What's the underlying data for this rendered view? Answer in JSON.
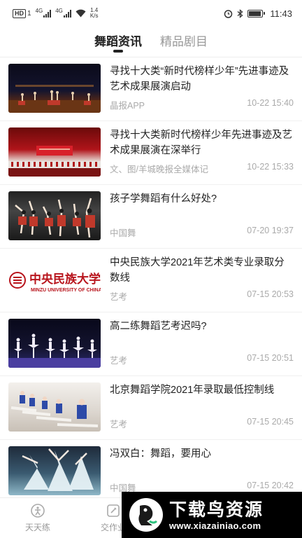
{
  "status_bar": {
    "hd": "HD",
    "sim": "1",
    "net1": "4G",
    "net2": "4G",
    "speed_value": "1.4",
    "speed_unit": "K/s",
    "battery_level": 0.85,
    "time": "11:43"
  },
  "tabs": [
    {
      "label": "舞蹈资讯",
      "active": true
    },
    {
      "label": "精品剧目",
      "active": false
    }
  ],
  "articles": [
    {
      "title": "寻找十大类“新时代榜样少年”先进事迹及艺术成果展演启动",
      "source": "晶报APP",
      "time": "10-22 15:40"
    },
    {
      "title": "寻找十大类新时代榜样少年先进事迹及艺术成果展演在深举行",
      "source": "文、图/羊城晚报全媒体记",
      "time": "10-22 15:33"
    },
    {
      "title": "孩子学舞蹈有什么好处?",
      "source": "中国舞",
      "time": "07-20 19:37"
    },
    {
      "title": "中央民族大学2021年艺术类专业录取分数线",
      "source": "艺考",
      "time": "07-15 20:53"
    },
    {
      "title": "高二练舞蹈艺考迟吗?",
      "source": "艺考",
      "time": "07-15 20:51"
    },
    {
      "title": "北京舞蹈学院2021年录取最低控制线",
      "source": "艺考",
      "time": "07-15 20:45"
    },
    {
      "title": "冯双白：舞蹈，要用心",
      "source": "中国舞",
      "time": "07-15 20:42"
    }
  ],
  "thumb_logo": {
    "cn": "中央民族大学",
    "en": "MINZU UNIVERSITY OF CHINA"
  },
  "bottom_nav": [
    {
      "label": "天天练",
      "icon": "dancer-icon"
    },
    {
      "label": "交作业",
      "icon": "edit-icon"
    }
  ],
  "watermark": {
    "cn": "下载鸟资源",
    "url": "www.xiazainiao.com"
  },
  "colors": {
    "accent": "#222222",
    "inactive": "#999999",
    "meta": "#aaaaaa"
  }
}
